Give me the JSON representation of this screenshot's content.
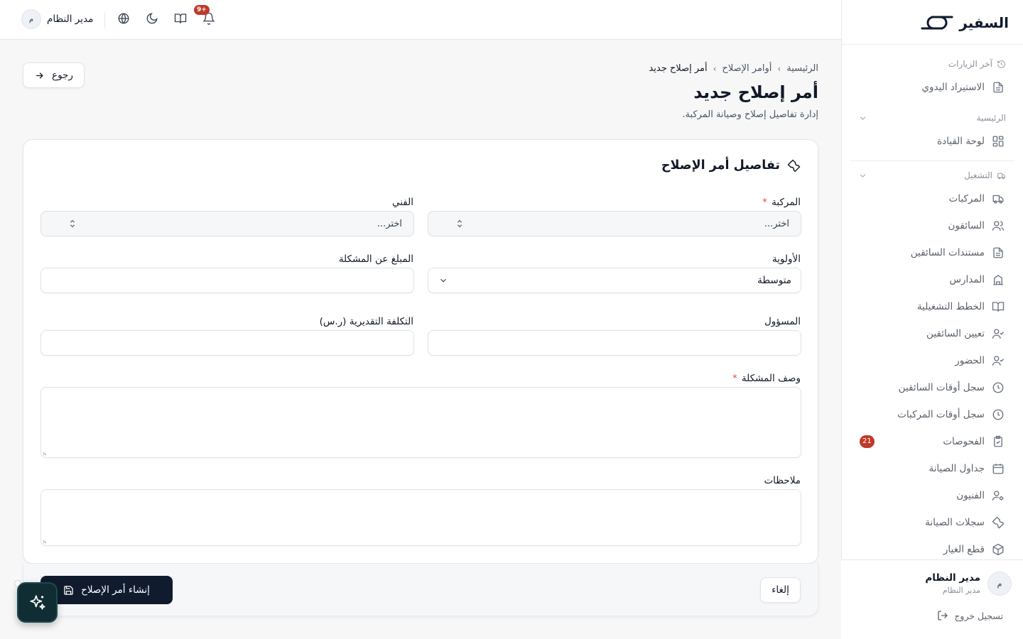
{
  "app": {
    "brand": "السفير",
    "colors": {
      "primary": "#101b2e",
      "danger": "#c0392b",
      "fab": "#0f2d33"
    }
  },
  "topbar": {
    "user_name": "مدير النظام",
    "user_initial": "م",
    "notifications_badge": "+9",
    "icons": [
      "globe-icon",
      "moon-icon",
      "book-open-icon",
      "bell-icon"
    ]
  },
  "sidebar": {
    "recent_label": "آخر الزيارات",
    "recent_items": [
      {
        "label": "الاستيراد اليدوي",
        "icon": "file-text-icon"
      }
    ],
    "groups": [
      {
        "label": "الرئيسية",
        "items": [
          {
            "label": "لوحة القيادة",
            "icon": "layout-grid-icon"
          }
        ]
      },
      {
        "label": "التشغيل",
        "items": [
          {
            "label": "المركبات",
            "icon": "truck-icon"
          },
          {
            "label": "السائقون",
            "icon": "users-icon"
          },
          {
            "label": "مستندات السائقين",
            "icon": "file-text-icon"
          },
          {
            "label": "المدارس",
            "icon": "building-icon"
          },
          {
            "label": "الخطط التشغيلية",
            "icon": "book-open-icon"
          },
          {
            "label": "تعيين السائقين",
            "icon": "user-check-icon"
          },
          {
            "label": "الحضور",
            "icon": "user-check-icon"
          },
          {
            "label": "سجل أوقات السائقين",
            "icon": "clock-icon"
          },
          {
            "label": "سجل أوقات المركبات",
            "icon": "clock-icon"
          },
          {
            "label": "الفحوصات",
            "icon": "clipboard-check-icon",
            "badge": "21"
          },
          {
            "label": "جداول الصيانة",
            "icon": "calendar-icon"
          },
          {
            "label": "الفنيون",
            "icon": "user-cog-icon"
          },
          {
            "label": "سجلات الصيانة",
            "icon": "wrench-icon"
          },
          {
            "label": "قطع الغيار",
            "icon": "package-icon"
          }
        ]
      }
    ],
    "footer": {
      "user_name": "مدير النظام",
      "user_role": "مدير النظام",
      "user_initial": "م",
      "logout_label": "تسجيل خروج"
    }
  },
  "page": {
    "back_label": "رجوع",
    "breadcrumb": [
      "الرئيسية",
      "أوامر الإصلاح",
      "أمر إصلاح جديد"
    ],
    "title": "أمر إصلاح جديد",
    "subtitle": "إدارة تفاصيل إصلاح وصيانة المركبة."
  },
  "form": {
    "section_title": "تفاصيل أمر الإصلاح",
    "vehicle": {
      "label": "المركبة",
      "required_mark": "*",
      "value": "اختر..."
    },
    "technician": {
      "label": "الفني",
      "value": "اختر..."
    },
    "priority": {
      "label": "الأولوية",
      "value": "متوسطة"
    },
    "reporter": {
      "label": "المبلغ عن المشكلة",
      "value": ""
    },
    "assignee": {
      "label": "المسؤول",
      "value": ""
    },
    "estimated_cost": {
      "label": "التكلفة التقديرية (ر.س)",
      "value": ""
    },
    "description": {
      "label": "وصف المشكلة",
      "required_mark": "*",
      "value": ""
    },
    "notes": {
      "label": "ملاحظات",
      "value": ""
    },
    "cancel_label": "إلغاء",
    "submit_label": "إنشاء أمر الإصلاح"
  }
}
